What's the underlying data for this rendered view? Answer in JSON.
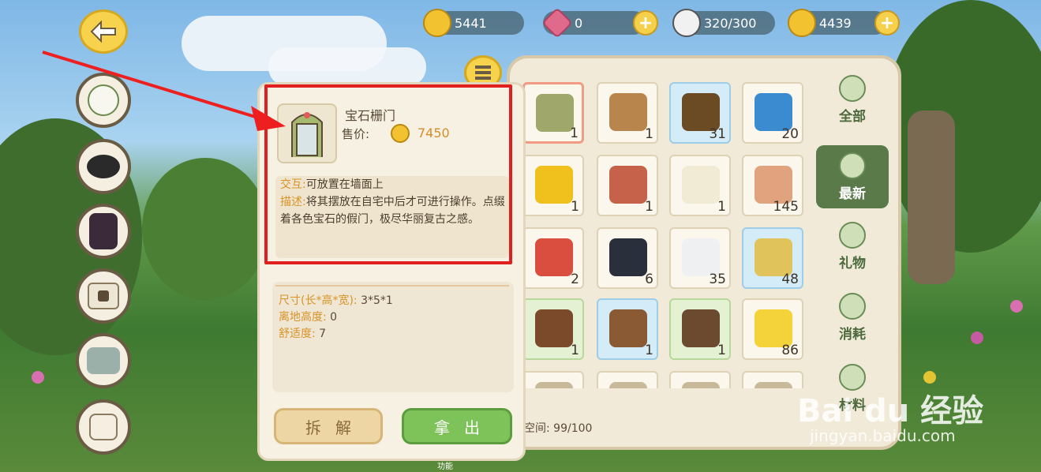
{
  "currencies": [
    {
      "icon": "gold-coin-icon",
      "value": "5441",
      "has_plus": false
    },
    {
      "icon": "gem-icon",
      "value": "0",
      "has_plus": true
    },
    {
      "icon": "rice-ball-icon",
      "value": "320/300",
      "has_plus": false
    },
    {
      "icon": "gold-shell-icon",
      "value": "4439",
      "has_plus": true
    }
  ],
  "left_nav": [
    {
      "name": "back-button",
      "icon": "back-arrow-icon"
    },
    {
      "name": "turnip-icon"
    },
    {
      "name": "hat-icon"
    },
    {
      "name": "outfit-icon"
    },
    {
      "name": "locked-bag-icon"
    },
    {
      "name": "boots-icon"
    },
    {
      "name": "backpack-icon"
    }
  ],
  "item": {
    "name": "宝石栅门",
    "price_label": "售价:",
    "price": "7450",
    "interaction_key": "交互:",
    "interaction_text": "可放置在墙面上",
    "description_key": "描述:",
    "description_text": "将其摆放在自宅中后才可进行操作。点缀着各色宝石的假门，极尽华丽复古之感。",
    "size_key": "尺寸(长*高*宽):",
    "size_value": "3*5*1",
    "height_key": "离地高度:",
    "height_value": "0",
    "comfort_key": "舒适度:",
    "comfort_value": "7"
  },
  "buttons": {
    "disassemble": "拆解",
    "take_out": "拿出"
  },
  "bottom_label": "功能",
  "inventory": {
    "space": "空间: 99/100",
    "slots": [
      {
        "count": "1",
        "bg": "plain",
        "selected": true,
        "icon": "gem-door-icon",
        "color": "#9fa86a"
      },
      {
        "count": "1",
        "bg": "plain",
        "icon": "gramophone-icon",
        "color": "#b8864d"
      },
      {
        "count": "31",
        "bg": "blue",
        "icon": "log-icon",
        "color": "#6b4b24"
      },
      {
        "count": "20",
        "bg": "plain",
        "icon": "ingot-icon",
        "color": "#3b8bd0"
      },
      {
        "count": "1",
        "bg": "plain",
        "icon": "gold-nugget-icon",
        "color": "#f0c11c"
      },
      {
        "count": "1",
        "bg": "plain",
        "icon": "wreath-icon",
        "color": "#c6624a"
      },
      {
        "count": "1",
        "bg": "plain",
        "icon": "wool-icon",
        "color": "#f1ead5"
      },
      {
        "count": "145",
        "bg": "plain",
        "icon": "egg-icon",
        "color": "#e0a37e"
      },
      {
        "count": "2",
        "bg": "plain",
        "icon": "tomato-ball-icon",
        "color": "#d94e3f"
      },
      {
        "count": "6",
        "bg": "plain",
        "icon": "black-flower-icon",
        "color": "#2a2f3c"
      },
      {
        "count": "35",
        "bg": "plain",
        "icon": "white-fur-icon",
        "color": "#eef0f2"
      },
      {
        "count": "48",
        "bg": "blue",
        "icon": "bamboo-icon",
        "color": "#e0c35a"
      },
      {
        "count": "1",
        "bg": "green",
        "icon": "piano-icon",
        "color": "#7a4a2a"
      },
      {
        "count": "1",
        "bg": "blue",
        "icon": "coat-rack-icon",
        "color": "#8a5a34"
      },
      {
        "count": "1",
        "bg": "green",
        "icon": "table-icon",
        "color": "#6b4a30"
      },
      {
        "count": "86",
        "bg": "plain",
        "icon": "sand-pile-icon",
        "color": "#f3d23a"
      },
      {
        "count": "",
        "bg": "plain",
        "icon": "partial-item-icon",
        "color": "#c8b99a"
      },
      {
        "count": "",
        "bg": "plain",
        "icon": "partial-item-icon",
        "color": "#c8b99a"
      },
      {
        "count": "",
        "bg": "plain",
        "icon": "partial-item-icon",
        "color": "#c8b99a"
      },
      {
        "count": "",
        "bg": "plain",
        "icon": "partial-item-icon",
        "color": "#c8b99a"
      }
    ]
  },
  "tabs": [
    {
      "label": "全部",
      "icon": "star-icon",
      "active": false
    },
    {
      "label": "最新",
      "icon": "bell-icon",
      "active": true
    },
    {
      "label": "礼物",
      "icon": "gift-icon",
      "active": false
    },
    {
      "label": "消耗",
      "icon": "rice-ball-icon",
      "active": false
    },
    {
      "label": "材料",
      "icon": "material-icon",
      "active": false
    }
  ],
  "watermark": {
    "main": "Bai du 经验",
    "sub": "jingyan.baidu.com"
  }
}
